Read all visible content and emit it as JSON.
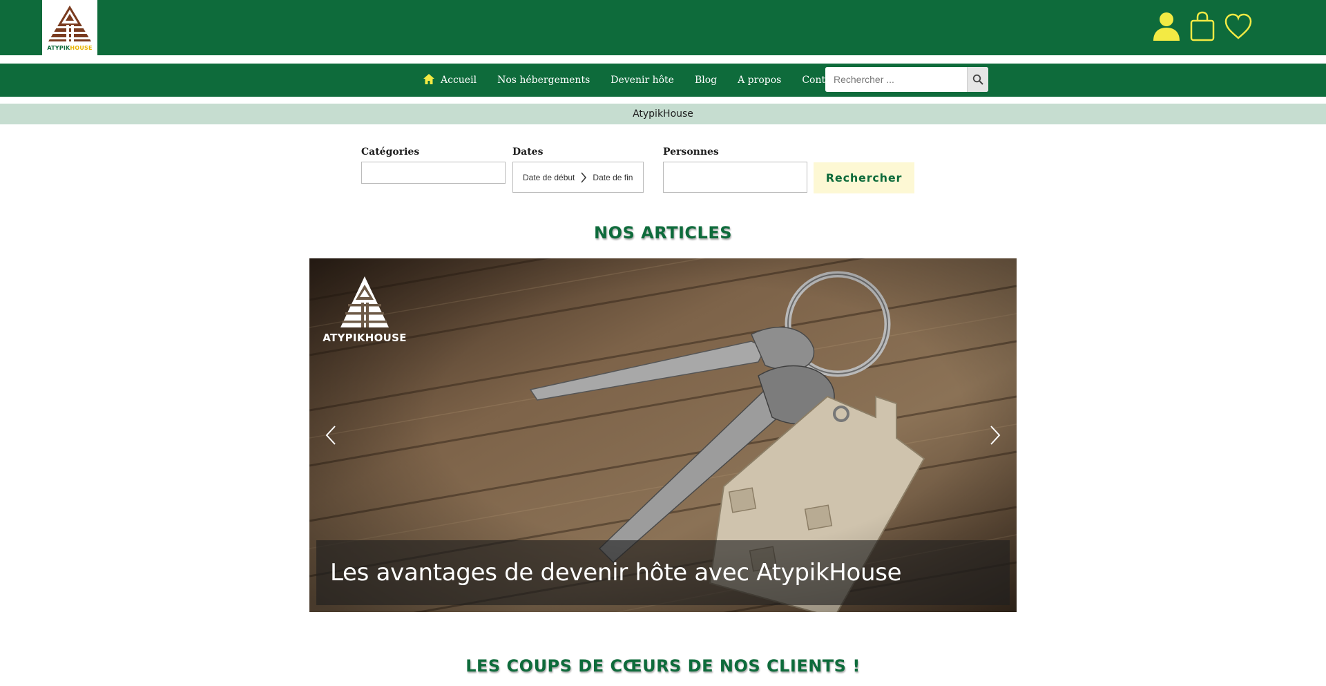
{
  "header": {
    "logo_text_1": "ATYPIK",
    "logo_text_2": "HOUSE",
    "icons": [
      "user-icon",
      "shopping-bag-icon",
      "heart-icon"
    ],
    "colors": {
      "brand_green": "#0e6b3b",
      "accent_yellow": "#f3ea44"
    }
  },
  "nav": {
    "items": [
      {
        "label": "Accueil",
        "icon": "home-icon"
      },
      {
        "label": "Nos hébergements"
      },
      {
        "label": "Devenir hôte"
      },
      {
        "label": "Blog"
      },
      {
        "label": "A propos"
      },
      {
        "label": "Contact"
      }
    ],
    "search_placeholder": "Rechercher ..."
  },
  "subbar": {
    "text": "AtypikHouse"
  },
  "search_form": {
    "categories_label": "Catégories",
    "dates_label": "Dates",
    "date_start": "Date de début",
    "date_end": "Date de fin",
    "persons_label": "Personnes",
    "submit_label": "Rechercher"
  },
  "articles": {
    "title": "NOS ARTICLES",
    "slide_logo_text": "ATYPIKHOUSE",
    "slide_caption": "Les avantages de devenir hôte avec AtypikHouse"
  },
  "favorites": {
    "title": "LES COUPS DE CŒURS DE NOS CLIENTS !"
  }
}
